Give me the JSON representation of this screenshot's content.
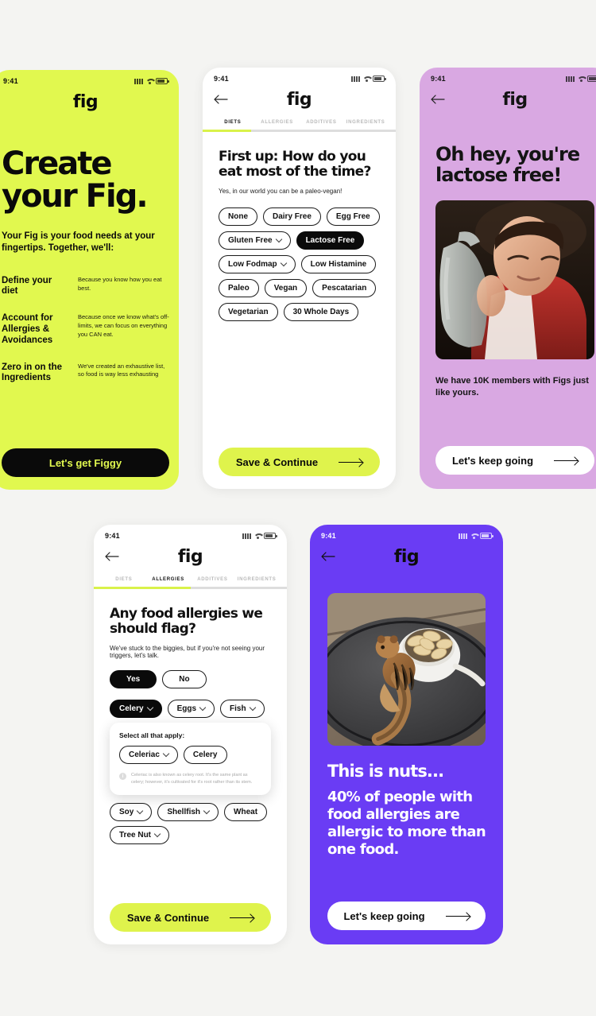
{
  "brand": {
    "logo": "fig",
    "green": "#e1f84f",
    "lavender": "#d9a8e2",
    "purple": "#6a3cf4",
    "black": "#0a0a0a"
  },
  "status_bar": {
    "time": "9:41",
    "icons": [
      "cellular-signal-icon",
      "wifi-icon",
      "battery-icon"
    ]
  },
  "intro_card": {
    "headline": "Create your Fig.",
    "lead": "Your Fig is your food needs at your fingertips. Together, we'll:",
    "features": [
      {
        "title": "Define your diet",
        "desc": "Because you know how you eat best."
      },
      {
        "title": "Account for Allergies & Avoidances",
        "desc": "Because once we know what's off-limits, we can focus on everything you CAN eat."
      },
      {
        "title": "Zero in on the Ingredients",
        "desc": "We've created an exhaustive list, so food is way less exhausting"
      }
    ],
    "cta": "Let's get Figgy"
  },
  "diets_card": {
    "tabs": [
      {
        "label": "DIETS",
        "active": true
      },
      {
        "label": "ALLERGIES",
        "active": false
      },
      {
        "label": "ADDITIVES",
        "active": false
      },
      {
        "label": "INGREDIENTS",
        "active": false
      }
    ],
    "progress_percent": 25,
    "question": "First up: How do you eat most of the time?",
    "subtext": "Yes, in our world you can be a paleo-vegan!",
    "chips": [
      {
        "label": "None",
        "dropdown": false,
        "selected": false
      },
      {
        "label": "Dairy Free",
        "dropdown": false,
        "selected": false
      },
      {
        "label": "Egg Free",
        "dropdown": false,
        "selected": false
      },
      {
        "label": "Gluten Free",
        "dropdown": true,
        "selected": false
      },
      {
        "label": "Lactose Free",
        "dropdown": false,
        "selected": true
      },
      {
        "label": "Low Fodmap",
        "dropdown": true,
        "selected": false
      },
      {
        "label": "Low Histamine",
        "dropdown": false,
        "selected": false
      },
      {
        "label": "Paleo",
        "dropdown": false,
        "selected": false
      },
      {
        "label": "Vegan",
        "dropdown": false,
        "selected": false
      },
      {
        "label": "Pescatarian",
        "dropdown": false,
        "selected": false
      },
      {
        "label": "Vegetarian",
        "dropdown": false,
        "selected": false
      },
      {
        "label": "30 Whole Days",
        "dropdown": false,
        "selected": false
      }
    ],
    "cta": "Save & Continue"
  },
  "lactose_card": {
    "headline": "Oh hey, you're lactose free!",
    "photo_alt": "man-hugging-milk-jug-photo",
    "caption": "We have 10K members with Figs just like yours.",
    "cta": "Let's keep going"
  },
  "allergies_card": {
    "tabs": [
      {
        "label": "DIETS",
        "active": false
      },
      {
        "label": "ALLERGIES",
        "active": true
      },
      {
        "label": "ADDITIVES",
        "active": false
      },
      {
        "label": "INGREDIENTS",
        "active": false
      }
    ],
    "progress_percent": 50,
    "question": "Any food allergies we should flag?",
    "subtext": "We've stuck to the biggies, but if you're not seeing your triggers, let's talk.",
    "yesno": [
      {
        "label": "Yes",
        "selected": true
      },
      {
        "label": "No",
        "selected": false
      }
    ],
    "chips_row1": [
      {
        "label": "Celery",
        "dropdown": true,
        "selected": true
      },
      {
        "label": "Eggs",
        "dropdown": true,
        "selected": false
      },
      {
        "label": "Fish",
        "dropdown": true,
        "selected": false
      }
    ],
    "tooltip": {
      "label": "Select all that apply:",
      "options": [
        {
          "label": "Celeriac",
          "dropdown": true
        },
        {
          "label": "Celery",
          "dropdown": false
        }
      ],
      "note": "Celeriac is also known as celery root. It's the same plant as celery; however, it's cultivated for it's root rather than its stem."
    },
    "chips_row2": [
      {
        "label": "Soy",
        "dropdown": true,
        "selected": false
      },
      {
        "label": "Shellfish",
        "dropdown": true,
        "selected": false
      },
      {
        "label": "Wheat",
        "dropdown": false,
        "selected": false
      }
    ],
    "chips_row3": [
      {
        "label": "Tree Nut",
        "dropdown": true,
        "selected": false
      }
    ],
    "cta": "Save & Continue"
  },
  "nuts_card": {
    "photo_alt": "chipmunk-eating-nuts-from-bowl-photo",
    "headline": "This is nuts...",
    "stat": "40% of people with food allergies are allergic to more than one food.",
    "cta": "Let's keep going"
  }
}
